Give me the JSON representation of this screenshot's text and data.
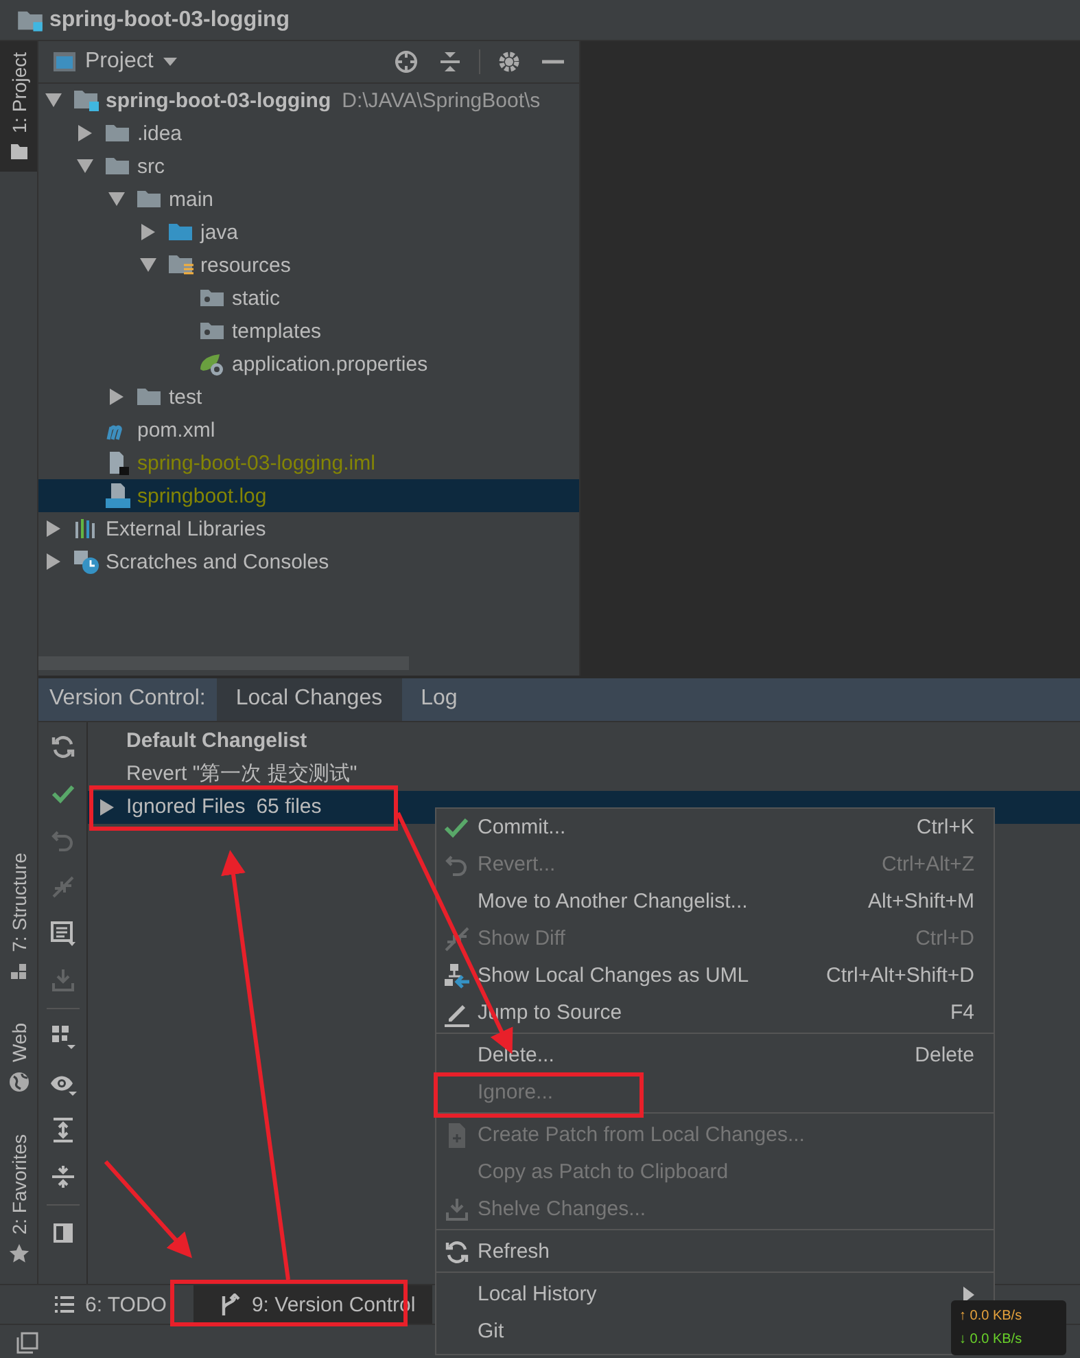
{
  "window": {
    "title": "spring-boot-03-logging"
  },
  "left_strip": {
    "top": [
      {
        "label": "1: Project",
        "kind": "folder",
        "selected": true
      }
    ],
    "bottom": [
      {
        "label": "7: Structure",
        "kind": "structure",
        "selected": false
      },
      {
        "label": "Web",
        "kind": "globe",
        "selected": false
      },
      {
        "label": "2: Favorites",
        "kind": "star",
        "selected": false
      }
    ]
  },
  "project_panel": {
    "title": "Project",
    "tree": [
      {
        "label": "spring-boot-03-logging",
        "path": "D:\\JAVA\\SpringBoot\\s",
        "kind": "module",
        "expanded": true,
        "selected": false,
        "ignored": false,
        "children": [
          {
            "label": ".idea",
            "kind": "folder",
            "expanded": false,
            "selected": false,
            "ignored": false
          },
          {
            "label": "src",
            "kind": "folder",
            "expanded": true,
            "selected": false,
            "ignored": false,
            "children": [
              {
                "label": "main",
                "kind": "folder",
                "expanded": true,
                "selected": false,
                "ignored": false,
                "children": [
                  {
                    "label": "java",
                    "kind": "source-folder",
                    "expanded": false,
                    "selected": false,
                    "ignored": false
                  },
                  {
                    "label": "resources",
                    "kind": "resources-folder",
                    "expanded": true,
                    "selected": false,
                    "ignored": false,
                    "children": [
                      {
                        "label": "static",
                        "kind": "plain-folder",
                        "selected": false,
                        "ignored": false
                      },
                      {
                        "label": "templates",
                        "kind": "plain-folder",
                        "selected": false,
                        "ignored": false
                      },
                      {
                        "label": "application.properties",
                        "kind": "spring",
                        "selected": false,
                        "ignored": false
                      }
                    ]
                  }
                ]
              },
              {
                "label": "test",
                "kind": "folder",
                "expanded": false,
                "selected": false,
                "ignored": false
              }
            ]
          },
          {
            "label": "pom.xml",
            "kind": "maven",
            "selected": false,
            "ignored": false
          },
          {
            "label": "spring-boot-03-logging.iml",
            "kind": "iml",
            "selected": false,
            "ignored": true
          },
          {
            "label": "springboot.log",
            "kind": "log",
            "selected": true,
            "ignored": true
          }
        ]
      },
      {
        "label": "External Libraries",
        "kind": "libraries",
        "expanded": false,
        "selected": false,
        "ignored": false
      },
      {
        "label": "Scratches and Consoles",
        "kind": "scratches",
        "expanded": false,
        "selected": false,
        "ignored": false
      }
    ]
  },
  "version_control": {
    "label": "Version Control:",
    "tabs": [
      {
        "label": "Local Changes",
        "selected": true
      },
      {
        "label": "Log",
        "selected": false
      }
    ],
    "toolbar": [
      {
        "kind": "refresh",
        "disabled": false
      },
      {
        "kind": "check",
        "disabled": false
      },
      {
        "kind": "undo",
        "disabled": true
      },
      {
        "kind": "merge",
        "disabled": true
      },
      {
        "kind": "list",
        "disabled": false
      },
      {
        "kind": "download",
        "disabled": true
      },
      {
        "kind": "separator"
      },
      {
        "kind": "group",
        "disabled": false
      },
      {
        "kind": "eye",
        "disabled": false
      },
      {
        "kind": "expand",
        "disabled": false
      },
      {
        "kind": "collapse",
        "disabled": false
      },
      {
        "kind": "separator"
      },
      {
        "kind": "preview",
        "disabled": false
      }
    ],
    "changelist": "Default Changelist",
    "rows": [
      {
        "label": "Revert \"第一次 提交测试\"",
        "selected": false
      },
      {
        "label": "Ignored Files",
        "count": "65 files",
        "expanded": false,
        "selected": true
      }
    ]
  },
  "context_menu": [
    {
      "kind": "check",
      "label": "Commit...",
      "shortcut": "Ctrl+K",
      "disabled": false
    },
    {
      "kind": "undo",
      "label": "Revert...",
      "shortcut": "Ctrl+Alt+Z",
      "disabled": true
    },
    {
      "kind": "plain",
      "label": "Move to Another Changelist...",
      "shortcut": "Alt+Shift+M",
      "disabled": false
    },
    {
      "kind": "diff",
      "label": "Show Diff",
      "shortcut": "Ctrl+D",
      "disabled": true
    },
    {
      "kind": "uml",
      "label": "Show Local Changes as UML",
      "shortcut": "Ctrl+Alt+Shift+D",
      "disabled": false
    },
    {
      "kind": "pencil",
      "label": "Jump to Source",
      "shortcut": "F4",
      "disabled": false
    },
    {
      "kind": "separator"
    },
    {
      "kind": "plain",
      "label": "Delete...",
      "shortcut": "Delete",
      "disabled": false
    },
    {
      "kind": "plain",
      "label": "Ignore...",
      "disabled": true
    },
    {
      "kind": "separator"
    },
    {
      "kind": "patch",
      "label": "Create Patch from Local Changes...",
      "disabled": true
    },
    {
      "kind": "plain",
      "label": "Copy as Patch to Clipboard",
      "disabled": true
    },
    {
      "kind": "shelve",
      "label": "Shelve Changes...",
      "disabled": true
    },
    {
      "kind": "separator"
    },
    {
      "kind": "refresh",
      "label": "Refresh",
      "disabled": false
    },
    {
      "kind": "separator"
    },
    {
      "kind": "plain",
      "label": "Local History",
      "submenu": true,
      "disabled": false
    },
    {
      "kind": "plain",
      "label": "Git",
      "disabled": false
    }
  ],
  "bottom_tabs": [
    {
      "label": "6: TODO",
      "kind": "list",
      "selected": false
    },
    {
      "label": "9: Version Control",
      "kind": "vcs",
      "selected": true
    }
  ],
  "network_monitor": {
    "upload": "↑ 0.0 KB/s",
    "download": "↓ 0.0 KB/s"
  }
}
